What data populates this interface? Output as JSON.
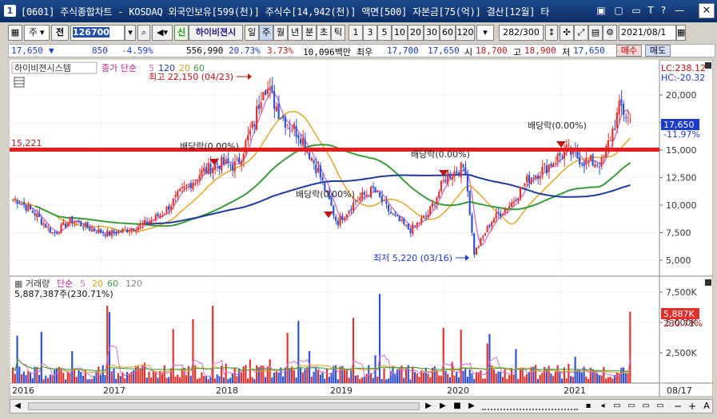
{
  "window": {
    "title": "[0601] 주식종합차트 - KOSDAQ 외국인보유[599(천)] 주식수[14,942(천)] 액면[500] 자본금[75(억)] 결산[12월] 타",
    "icon_label": "1",
    "buttons": [
      "▣",
      "▢",
      "▭",
      "T",
      "?",
      "—",
      "✕"
    ]
  },
  "toolbar": {
    "market": "주",
    "mode": "전",
    "stock_code": "126700",
    "badge": "신",
    "stock_name": "하이비젼시",
    "periods": [
      "일",
      "주",
      "월",
      "년",
      "분",
      "초",
      "틱"
    ],
    "active_period": "주",
    "intervals": [
      "1",
      "3",
      "5",
      "10",
      "20",
      "30",
      "60",
      "120"
    ],
    "count": "282",
    "count_max": "/300",
    "date": "2021/08/1"
  },
  "quote": {
    "price": "17,650",
    "down_arrow": "▼",
    "change": "850",
    "change_pct": "-4.59%",
    "volume": "556,990",
    "turnover_pct": "20.73%",
    "foreign_pct": "3.73%",
    "amount": "10,096백만",
    "min_label": "최우",
    "best_ask": "17,700",
    "best_bid": "17,650",
    "open_label": "시",
    "open": "18,700",
    "high_label": "고",
    "high": "18,900",
    "low_label": "저",
    "low": "17,650",
    "buy_label": "매수",
    "sell_label": "매도"
  },
  "price_panel": {
    "legend_stock": "하이비젼시스템",
    "legend_ma": "종가 단순",
    "ma_periods": [
      "5",
      "120",
      "20",
      "60"
    ],
    "lc": "LC:238.12",
    "hc": "HC:-20.32",
    "y_ticks": [
      "20,000",
      "17,500",
      "15,000",
      "12,500",
      "10,000",
      "7,500",
      "5,000"
    ],
    "last_price": "17,650",
    "last_pct": "-11.97%",
    "hline_value": "15,221",
    "high_annotation": "최고 22,150 (04/23)",
    "low_annotation": "최저 5,220 (03/16)",
    "dividend": "배당락(0.00%)"
  },
  "volume_panel": {
    "legend_title": "거래량",
    "legend_ma": "단순",
    "ma_periods": [
      "5",
      "20",
      "60",
      "120"
    ],
    "current": "5,887,387주(230.71%)",
    "y_ticks": [
      "7,500K",
      "5,000K",
      "2,500K"
    ],
    "last_value": "5,887K",
    "last_pct": "230.71%"
  },
  "x_axis": {
    "labels": [
      "2016",
      "2017",
      "2018",
      "2019",
      "2020",
      "2021"
    ],
    "last": "08/17"
  },
  "colors": {
    "up": "#e0302b",
    "down": "#2d4fd0",
    "ma5": "#d070d0",
    "ma20": "#e0a020",
    "ma60": "#3a9a3a",
    "ma120": "#1f3a9a",
    "hline": "#e81c1c",
    "title_bg": "#1e4a8c"
  },
  "chart_data": {
    "type": "candlestick",
    "title": "하이비젼시스템",
    "x_range": [
      "2016",
      "2021/08/17"
    ],
    "ylim": [
      4500,
      22500
    ],
    "weekly_close_path": [
      [
        "2016-01",
        10500
      ],
      [
        "2016-03",
        9200
      ],
      [
        "2016-05",
        7400
      ],
      [
        "2016-07",
        8700
      ],
      [
        "2016-09",
        7800
      ],
      [
        "2016-11",
        7400
      ],
      [
        "2017-01",
        7800
      ],
      [
        "2017-03",
        8300
      ],
      [
        "2017-05",
        9300
      ],
      [
        "2017-07",
        11200
      ],
      [
        "2017-09",
        12900
      ],
      [
        "2017-11",
        13800
      ],
      [
        "2018-01",
        13600
      ],
      [
        "2018-03",
        17500
      ],
      [
        "2018-04",
        21200
      ],
      [
        "2018-06",
        18000
      ],
      [
        "2018-08",
        16400
      ],
      [
        "2018-10",
        13000
      ],
      [
        "2018-12",
        8400
      ],
      [
        "2019-02",
        10400
      ],
      [
        "2019-04",
        11400
      ],
      [
        "2019-06",
        9100
      ],
      [
        "2019-08",
        7700
      ],
      [
        "2019-10",
        9200
      ],
      [
        "2019-12",
        12700
      ],
      [
        "2020-02",
        13500
      ],
      [
        "2020-03",
        5600
      ],
      [
        "2020-05",
        8700
      ],
      [
        "2020-07",
        10100
      ],
      [
        "2020-09",
        12500
      ],
      [
        "2020-11",
        13500
      ],
      [
        "2021-01",
        15000
      ],
      [
        "2021-03",
        14000
      ],
      [
        "2021-05",
        13800
      ],
      [
        "2021-07",
        19000
      ],
      [
        "2021-08",
        17650
      ]
    ]
  }
}
